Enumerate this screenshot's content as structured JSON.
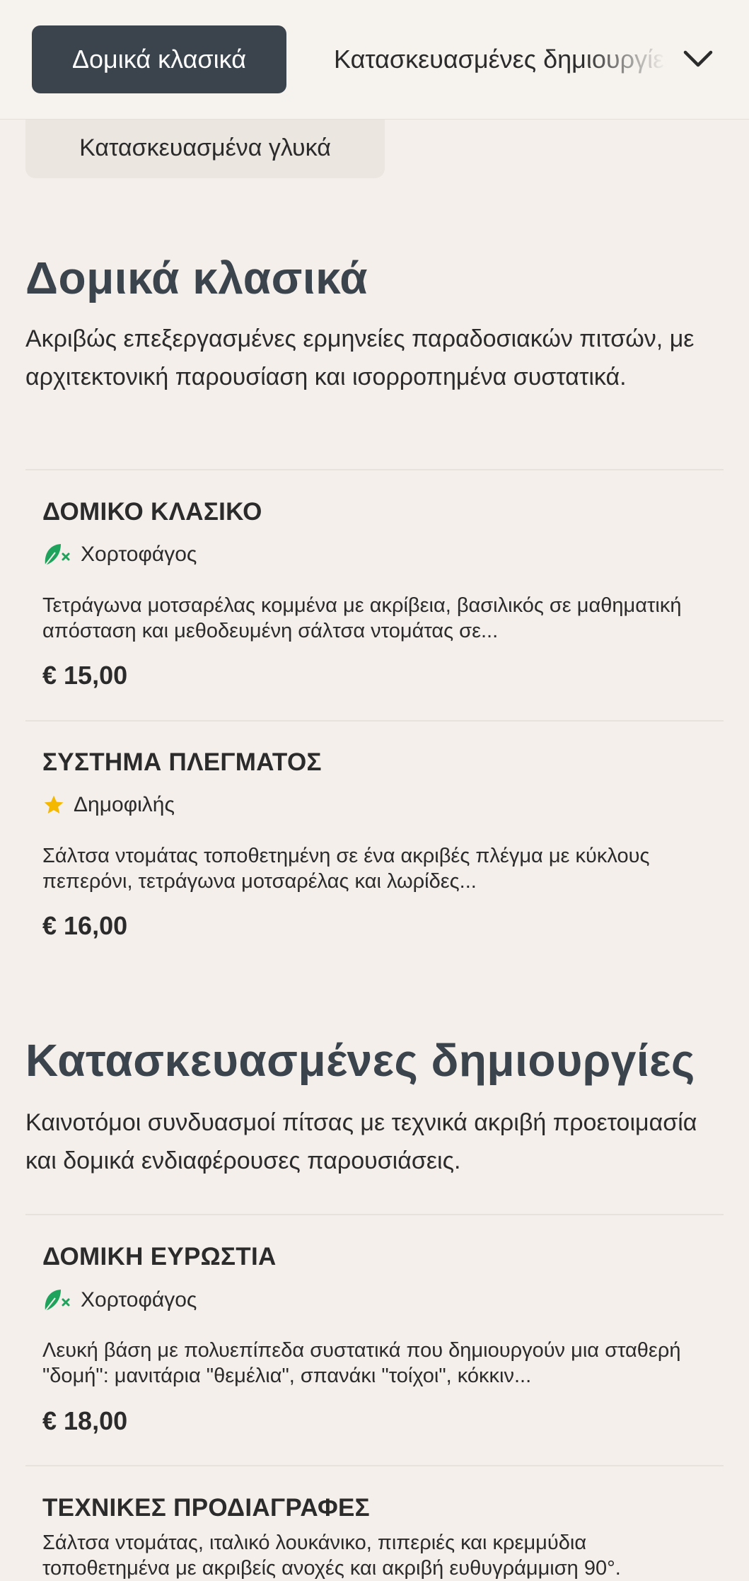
{
  "nav": {
    "active_tab": "Δομικά κλασικά",
    "second_tab": "Κατασκευασμένες δημιουργίες",
    "expand_icon": "chevron-down-icon",
    "third_tab": "Κατασκευασμένα γλυκά"
  },
  "sections": [
    {
      "title": "Δομικά κλασικά",
      "description": "Ακριβώς επεξεργασμένες ερμηνείες παραδοσιακών πιτσών, με αρχιτεκτονική παρουσίαση και ισορροπημένα συστατικά.",
      "items": [
        {
          "name": "ΔΟΜΙΚΟ ΚΛΑΣΙΚΟ",
          "tag": "Χορτοφάγος",
          "tag_icon": "vegetarian-leaf-icon",
          "description": "Τετράγωνα μοτσαρέλας κομμένα με ακρίβεια, βασιλικός σε μαθηματική απόσταση και μεθοδευμένη σάλτσα ντομάτας σε...",
          "price": "€ 15,00"
        },
        {
          "name": "ΣΥΣΤΗΜΑ ΠΛΕΓΜΑΤΟΣ",
          "tag": "Δημοφιλής",
          "tag_icon": "star-icon",
          "description": "Σάλτσα ντομάτας τοποθετημένη σε ένα ακριβές πλέγμα με κύκλους πεπερόνι, τετράγωνα μοτσαρέλας και λωρίδες...",
          "price": "€ 16,00"
        }
      ]
    },
    {
      "title": "Κατασκευασμένες δημιουργίες",
      "description": "Καινοτόμοι συνδυασμοί πίτσας με τεχνικά ακριβή προετοιμασία και δομικά ενδιαφέρουσες παρουσιάσεις.",
      "items": [
        {
          "name": "ΔΟΜΙΚΗ ΕΥΡΩΣΤΙΑ",
          "tag": "Χορτοφάγος",
          "tag_icon": "vegetarian-leaf-icon",
          "description": "Λευκή βάση με πολυεπίπεδα συστατικά που δημιουργούν μια σταθερή \"δομή\": μανιτάρια \"θεμέλια\", σπανάκι \"τοίχοι\", κόκκιν...",
          "price": "€ 18,00"
        },
        {
          "name": "ΤΕΧΝΙΚΕΣ ΠΡΟΔΙΑΓΡΑΦΕΣ",
          "description": "Σάλτσα ντομάτας, ιταλικό λουκάνικο, πιπεριές και κρεμμύδια τοποθετημένα με ακριβείς ανοχές και ακριβή ευθυγράμμιση 90°."
        }
      ]
    }
  ],
  "colors": {
    "background": "#f4efeb",
    "active_tab": "#3b444d",
    "heading": "#3b444d",
    "vegetarian_green": "#1fa35c",
    "star_yellow": "#f5b800"
  }
}
